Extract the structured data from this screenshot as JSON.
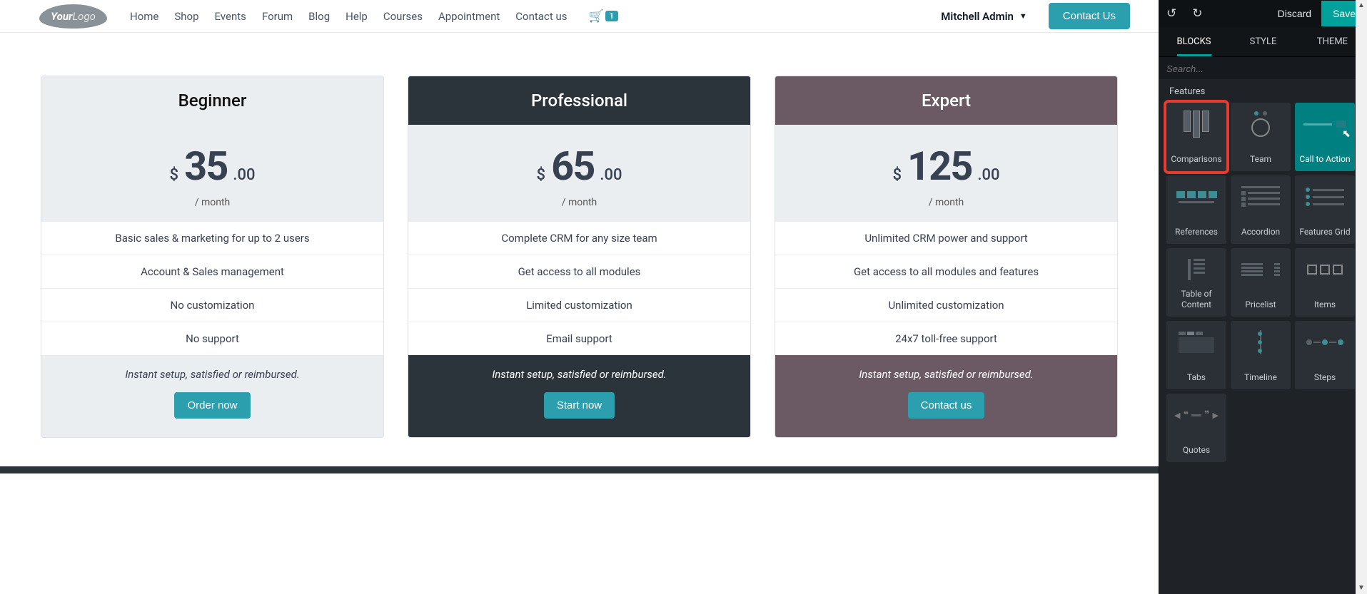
{
  "nav": {
    "logo_prefix": "Your",
    "logo_suffix": "Logo",
    "links": [
      "Home",
      "Shop",
      "Events",
      "Forum",
      "Blog",
      "Help",
      "Courses",
      "Appointment",
      "Contact us"
    ],
    "cart_count": "1",
    "user_name": "Mitchell Admin",
    "contact_btn": "Contact Us"
  },
  "plans": [
    {
      "variant": "beginner",
      "title": "Beginner",
      "currency": "$",
      "amount": "35",
      "cents": ".00",
      "period": "/ month",
      "features": [
        "Basic sales & marketing for up to 2 users",
        "Account & Sales management",
        "No customization",
        "No support"
      ],
      "note": "Instant setup, satisfied or reimbursed.",
      "cta": "Order now"
    },
    {
      "variant": "professional",
      "title": "Professional",
      "currency": "$",
      "amount": "65",
      "cents": ".00",
      "period": "/ month",
      "features": [
        "Complete CRM for any size team",
        "Get access to all modules",
        "Limited customization",
        "Email support"
      ],
      "note": "Instant setup, satisfied or reimbursed.",
      "cta": "Start now"
    },
    {
      "variant": "expert",
      "title": "Expert",
      "currency": "$",
      "amount": "125",
      "cents": ".00",
      "period": "/ month",
      "features": [
        "Unlimited CRM power and support",
        "Get access to all modules and features",
        "Unlimited customization",
        "24x7 toll-free support"
      ],
      "note": "Instant setup, satisfied or reimbursed.",
      "cta": "Contact us"
    }
  ],
  "sidebar": {
    "discard": "Discard",
    "save": "Save",
    "tabs": [
      "BLOCKS",
      "STYLE",
      "THEME"
    ],
    "search_placeholder": "Search...",
    "section_title": "Features",
    "blocks": [
      {
        "label": "Comparisons",
        "thumb": "bars",
        "highlighted": true
      },
      {
        "label": "Team",
        "thumb": "team"
      },
      {
        "label": "Call to Action",
        "thumb": "cta",
        "hover": true
      },
      {
        "label": "References",
        "thumb": "refs"
      },
      {
        "label": "Accordion",
        "thumb": "acc"
      },
      {
        "label": "Features Grid",
        "thumb": "dots"
      },
      {
        "label": "Table of Content",
        "thumb": "toc"
      },
      {
        "label": "Pricelist",
        "thumb": "pricelist"
      },
      {
        "label": "Items",
        "thumb": "items"
      },
      {
        "label": "Tabs",
        "thumb": "tabs"
      },
      {
        "label": "Timeline",
        "thumb": "timeline"
      },
      {
        "label": "Steps",
        "thumb": "steps"
      },
      {
        "label": "Quotes",
        "thumb": "quotes"
      }
    ]
  }
}
